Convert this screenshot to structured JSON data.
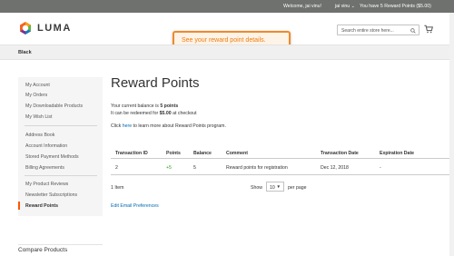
{
  "topbar": {
    "welcome": "Welcome, jai vinu!",
    "user_menu": "jai vinu",
    "rewards": "You have 5 Reward Points ($5.00)"
  },
  "header": {
    "logo_text": "LUMA",
    "search_placeholder": "Search entire store here...",
    "tooltip": "See your reward point details."
  },
  "nav": {
    "items": [
      "Black"
    ]
  },
  "sidebar": {
    "items": [
      "My Account",
      "My Orders",
      "My Downloadable Products",
      "My Wish List",
      "Address Book",
      "Account Information",
      "Stored Payment Methods",
      "Billing Agreements",
      "My Product Reviews",
      "Newsletter Subscriptions",
      "Reward Points"
    ]
  },
  "main": {
    "title": "Reward Points",
    "balance_prefix": "Your current balance is",
    "balance_value": "5 points",
    "redeem_prefix": "It can be redeemed for",
    "redeem_value": "$5.00",
    "redeem_suffix": "at checkout",
    "learn_prefix": "Click",
    "learn_link": "here",
    "learn_suffix": "to learn more about Reward Points program.",
    "table": {
      "headers": [
        "Transaction ID",
        "Points",
        "Balance",
        "Comment",
        "Transaction Date",
        "Expiration Date"
      ],
      "rows": [
        [
          "2",
          "+5",
          "5",
          "Reward points for registration",
          "Dec 12, 2018",
          "-"
        ]
      ]
    },
    "pager": {
      "count": "1 Item",
      "show_label": "Show",
      "limit_value": "10",
      "per_page_label": "per page"
    },
    "edit_pref": "Edit Email Preferences"
  },
  "footer": {
    "compare": "Compare Products"
  },
  "colors": {
    "accent": "#ef8a2b",
    "link": "#006bb4",
    "active": "#ff5501",
    "points": "#37a21f"
  }
}
